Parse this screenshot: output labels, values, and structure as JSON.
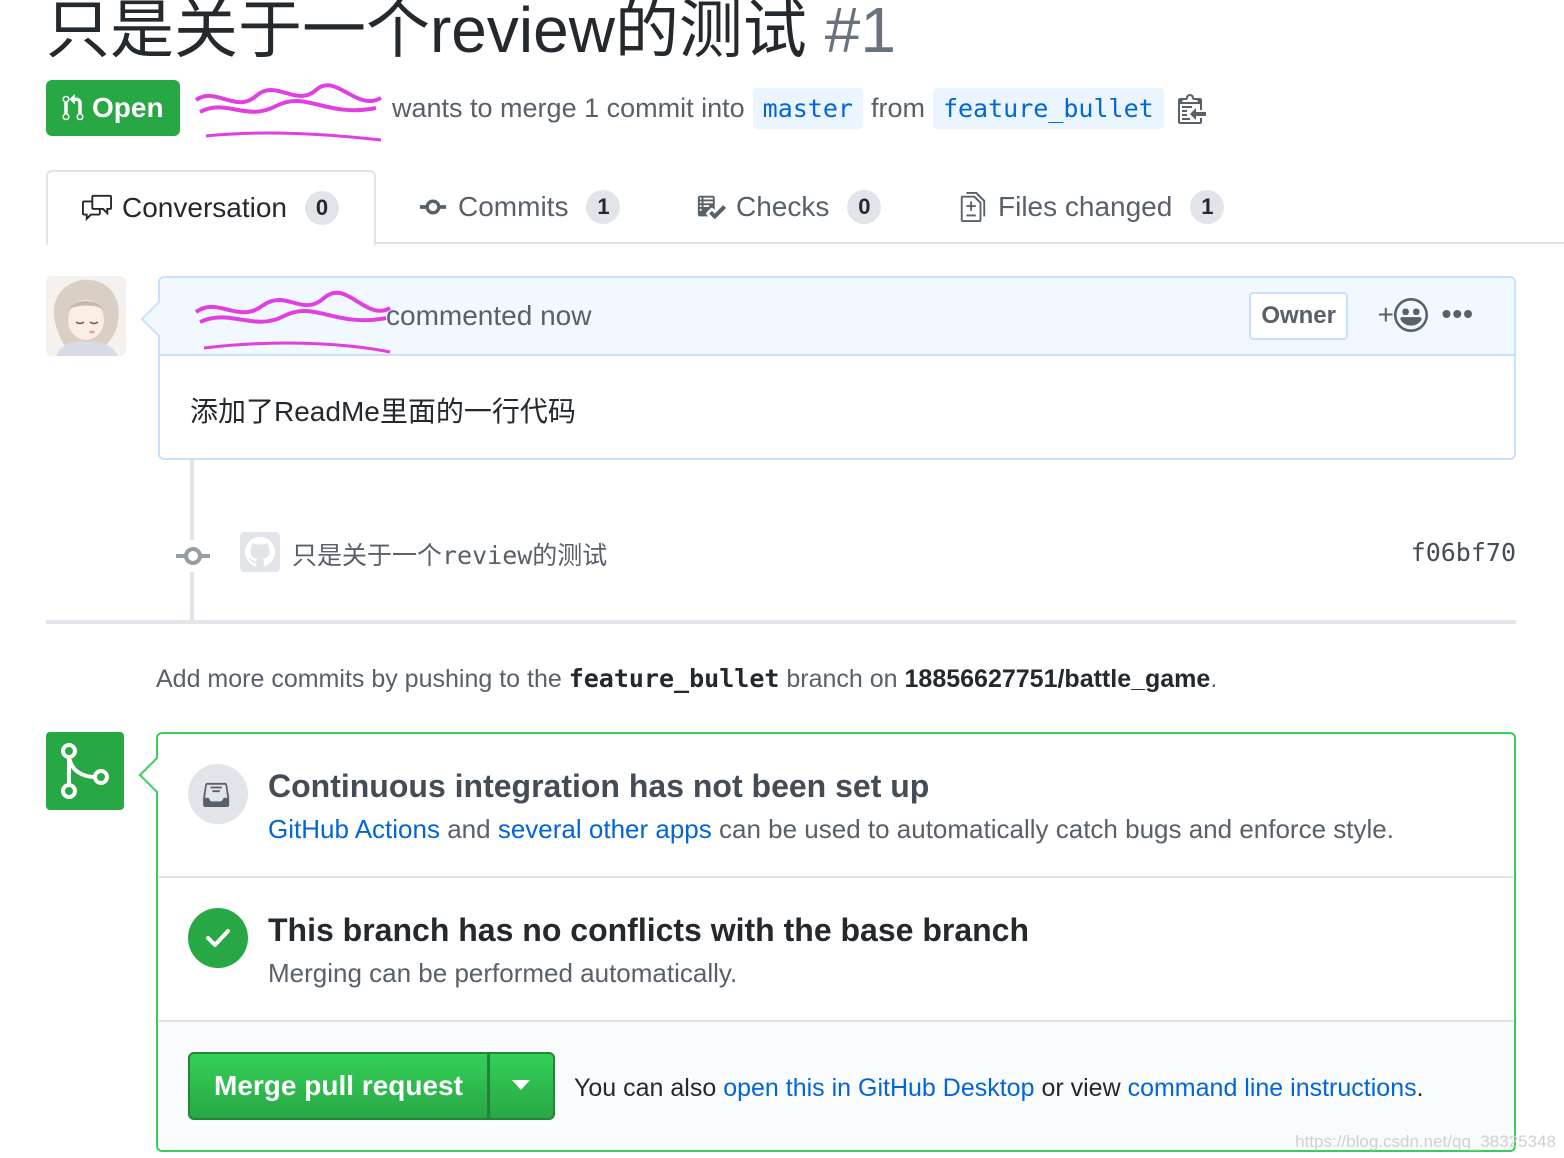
{
  "header": {
    "title": "只是关于一个review的测试",
    "number": "#1",
    "state": "Open",
    "meta_wants": "wants to merge 1 commit into",
    "base_branch": "master",
    "meta_from": "from",
    "head_branch": "feature_bullet"
  },
  "tabs": [
    {
      "label": "Conversation",
      "count": "0",
      "icon": "comment-discussion-icon"
    },
    {
      "label": "Commits",
      "count": "1",
      "icon": "git-commit-icon"
    },
    {
      "label": "Checks",
      "count": "0",
      "icon": "checklist-icon"
    },
    {
      "label": "Files changed",
      "count": "1",
      "icon": "file-diff-icon"
    }
  ],
  "comment": {
    "action": "commented now",
    "role_label": "Owner",
    "reaction_plus": "+",
    "more": "•••",
    "body": "添加了ReadMe里面的一行代码"
  },
  "commit": {
    "message": "只是关于一个review的测试",
    "sha": "f06bf70"
  },
  "push_hint": {
    "prefix": "Add more commits by pushing to the",
    "branch": "feature_bullet",
    "middle": "branch on",
    "repo": "18856627751/battle_game",
    "suffix": "."
  },
  "merge_box": {
    "ci_title": "Continuous integration has not been set up",
    "ci_link1": "GitHub Actions",
    "ci_and": "and",
    "ci_link2": "several other apps",
    "ci_rest": "can be used to automatically catch bugs and enforce style.",
    "conflict_title": "This branch has no conflicts with the base branch",
    "conflict_sub": "Merging can be performed automatically.",
    "merge_button": "Merge pull request",
    "also_prefix": "You can also",
    "also_link1": "open this in GitHub Desktop",
    "also_middle": "or view",
    "also_link2": "command line instructions",
    "also_suffix": "."
  },
  "watermark": "https://blog.csdn.net/qq_38325348",
  "colors": {
    "green": "#28a745",
    "link": "#0366d6",
    "header_bg": "#f1f8ff",
    "redaction": "#e040e0"
  }
}
